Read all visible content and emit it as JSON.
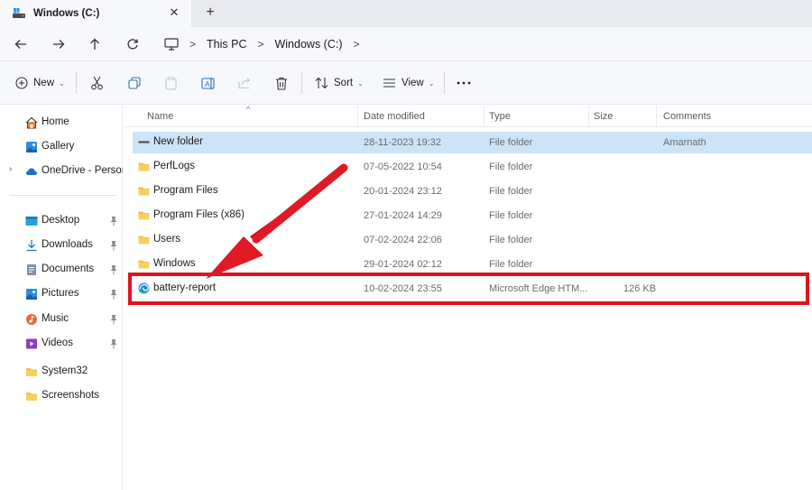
{
  "window": {
    "tab_title": "Windows (C:)"
  },
  "breadcrumb": {
    "items": [
      "This PC",
      "Windows (C:)"
    ]
  },
  "commandbar": {
    "new_label": "New",
    "sort_label": "Sort",
    "view_label": "View"
  },
  "sidebar": {
    "items": [
      {
        "label": "Home",
        "icon": "home-icon"
      },
      {
        "label": "Gallery",
        "icon": "gallery-icon"
      },
      {
        "label": "OneDrive - Persona",
        "icon": "cloud-icon"
      },
      {
        "label": "Desktop",
        "icon": "desktop-icon",
        "pinned": true
      },
      {
        "label": "Downloads",
        "icon": "download-icon",
        "pinned": true
      },
      {
        "label": "Documents",
        "icon": "documents-icon",
        "pinned": true
      },
      {
        "label": "Pictures",
        "icon": "pictures-icon",
        "pinned": true
      },
      {
        "label": "Music",
        "icon": "music-icon",
        "pinned": true
      },
      {
        "label": "Videos",
        "icon": "videos-icon",
        "pinned": true
      },
      {
        "label": "System32",
        "icon": "folder-icon"
      },
      {
        "label": "Screenshots",
        "icon": "folder-icon"
      }
    ]
  },
  "columns": {
    "name": "Name",
    "date": "Date modified",
    "type": "Type",
    "size": "Size",
    "comments": "Comments"
  },
  "files": [
    {
      "name": "New folder",
      "date": "28-11-2023 19:32",
      "type": "File folder",
      "size": "",
      "comments": "Amarnath",
      "selected": true
    },
    {
      "name": "PerfLogs",
      "date": "07-05-2022 10:54",
      "type": "File folder",
      "size": "",
      "comments": ""
    },
    {
      "name": "Program Files",
      "date": "20-01-2024 23:12",
      "type": "File folder",
      "size": "",
      "comments": ""
    },
    {
      "name": "Program Files (x86)",
      "date": "27-01-2024 14:29",
      "type": "File folder",
      "size": "",
      "comments": ""
    },
    {
      "name": "Users",
      "date": "07-02-2024 22:06",
      "type": "File folder",
      "size": "",
      "comments": ""
    },
    {
      "name": "Windows",
      "date": "29-01-2024 02:12",
      "type": "File folder",
      "size": "",
      "comments": ""
    },
    {
      "name": "battery-report",
      "date": "10-02-2024 23:55",
      "type": "Microsoft Edge HTM...",
      "size": "126 KB",
      "comments": "",
      "highlighted": true
    }
  ],
  "colors": {
    "accent_highlight": "#e0141f",
    "selection": "#cce4f7",
    "folder": "#f3c13a"
  }
}
